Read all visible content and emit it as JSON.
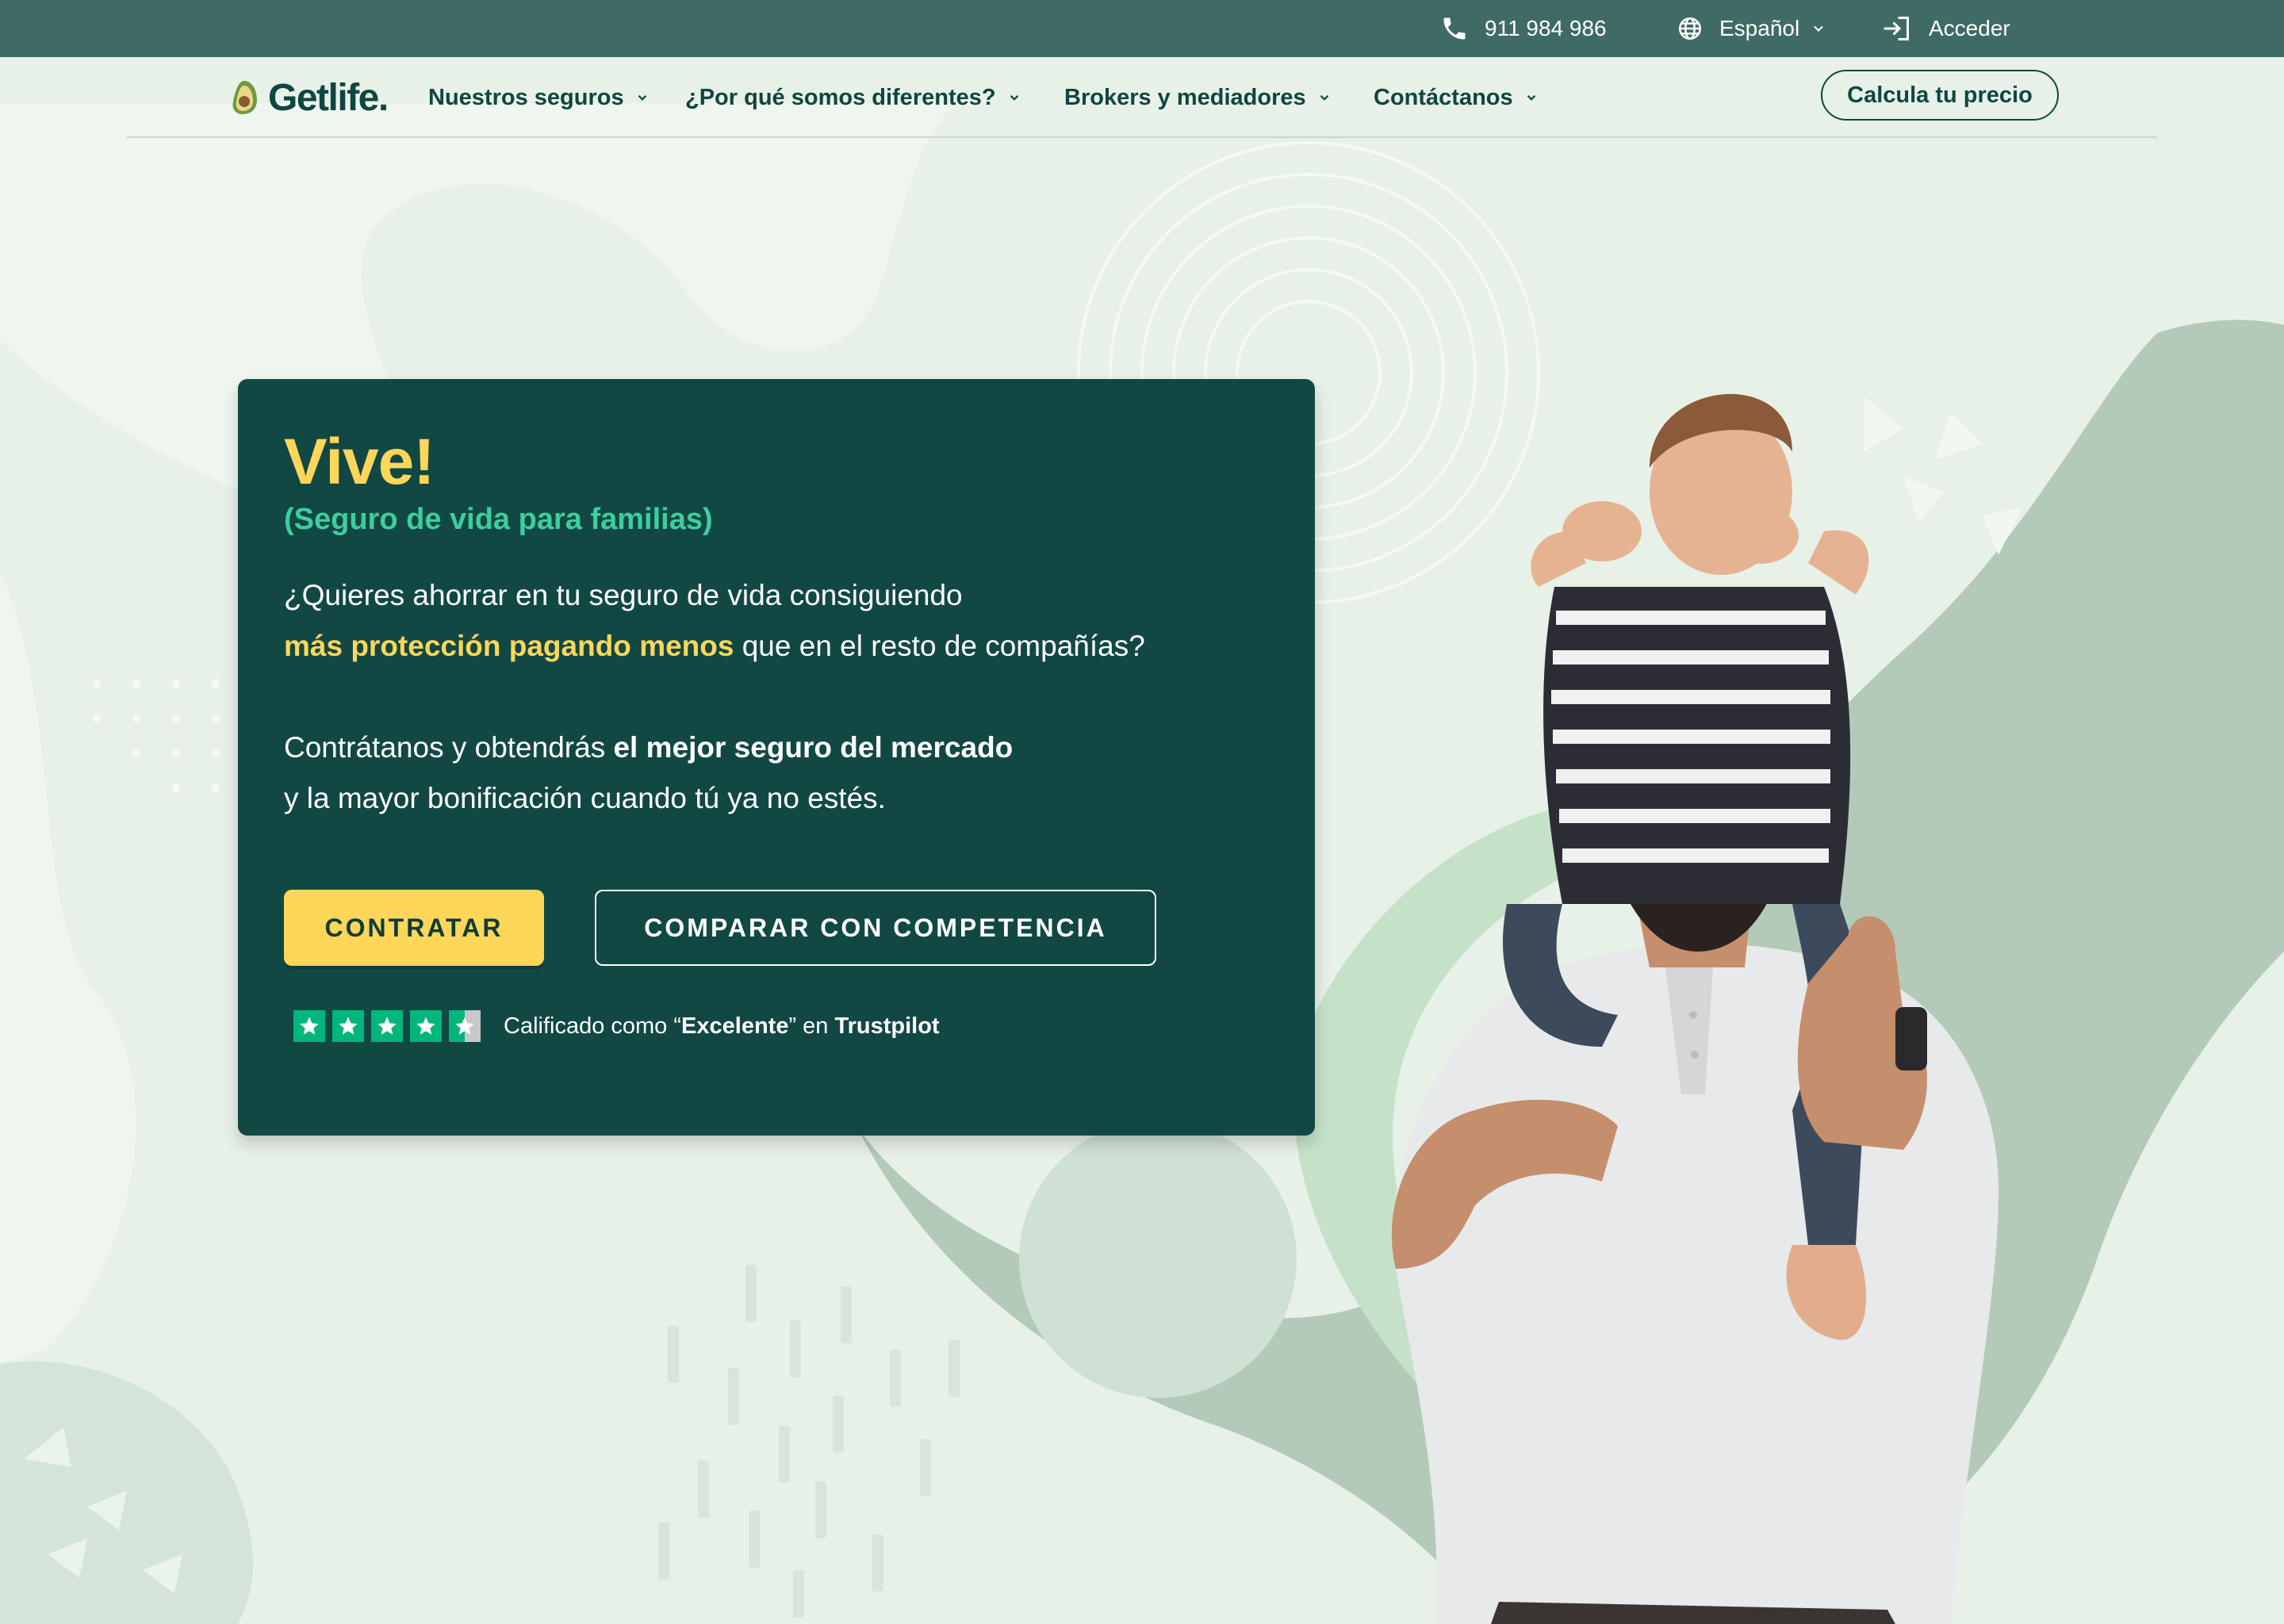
{
  "topbar": {
    "phone": "911 984 986",
    "language": "Español",
    "login": "Acceder",
    "icons": [
      "phone-icon",
      "globe-icon",
      "chevron-down-icon",
      "login-icon"
    ]
  },
  "nav": {
    "logo": "Getlife.",
    "menu": [
      {
        "label": "Nuestros seguros"
      },
      {
        "label": "¿Por qué somos diferentes?"
      },
      {
        "label": "Brokers y mediadores"
      },
      {
        "label": "Contáctanos"
      }
    ],
    "cta": "Calcula tu precio"
  },
  "hero": {
    "title": "Vive!",
    "subtitle": "(Seguro de vida para familias)",
    "p1_a": "¿Quieres ahorrar en tu seguro de vida consiguiendo",
    "p1_highlight": "más protección pagando menos",
    "p1_b": "que en el resto de compañías?",
    "p2_a": "Contrátanos y obtendrás",
    "p2_bold": "el mejor seguro del mercado",
    "p2_b": "y la mayor bonificación cuando tú ya no estés.",
    "btn_primary": "CONTRATAR",
    "btn_secondary": "COMPARAR CON COMPETENCIA",
    "rating_stars": 4.5,
    "trust_prefix": "Calificado como “",
    "trust_excellent": "Excelente",
    "trust_mid": "” en ",
    "trust_brand": "Trustpilot"
  },
  "colors": {
    "topbar": "#3f6b64",
    "background": "#e7f1e8",
    "card": "#124844",
    "accent_yellow": "#fdd65a",
    "accent_green": "#3ccf9c",
    "trustpilot": "#00b67a"
  }
}
